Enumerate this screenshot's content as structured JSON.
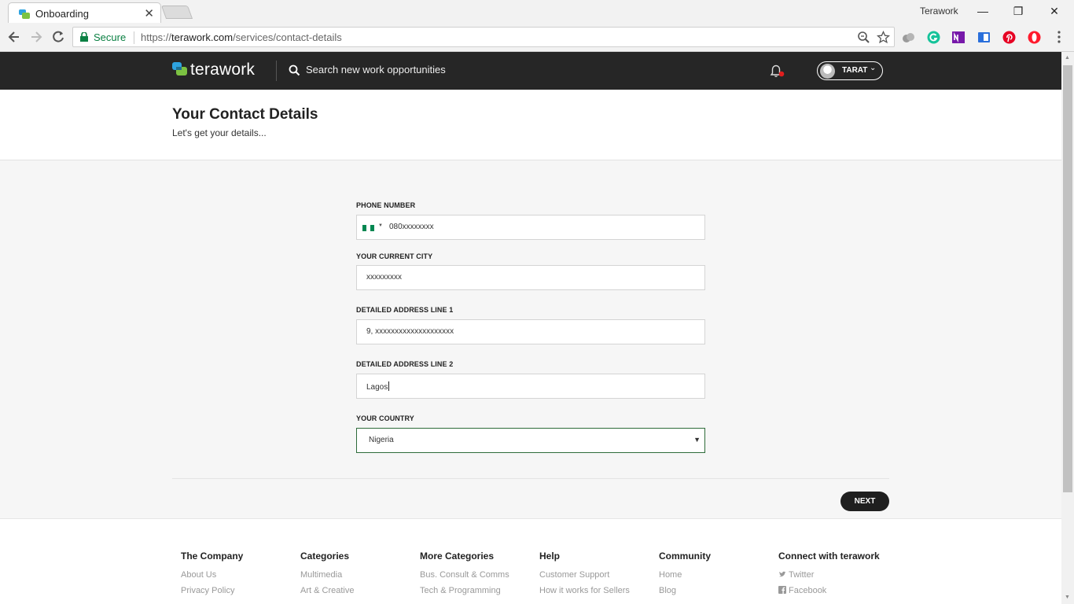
{
  "browser": {
    "tab_title": "Onboarding",
    "tab_close": "✕",
    "profile_name": "Terawork",
    "window_controls": {
      "minimize": "—",
      "restore": "❐",
      "close": "✕"
    },
    "secure_label": "Secure",
    "url_scheme": "https://",
    "url_host": "terawork.com",
    "url_path": "/services/contact-details",
    "extensions": [
      "cloud-icon",
      "grammarly-icon",
      "onenote-icon",
      "reader-icon",
      "pinterest-icon",
      "opera-icon"
    ]
  },
  "header": {
    "logo_text": "terawork",
    "search_placeholder": "Search new work opportunities",
    "user_name": "TARAT",
    "user_chevron": "⌄",
    "notification_dot_color": "#e01e1e"
  },
  "page": {
    "title": "Your Contact Details",
    "subtitle": "Let's get your details..."
  },
  "form": {
    "phone_label": "PHONE NUMBER",
    "phone_value": "080xxxxxxxx",
    "city_label": "YOUR CURRENT CITY",
    "city_value": "xxxxxxxxx",
    "address1_label": "DETAILED ADDRESS LINE 1",
    "address1_value": "9, xxxxxxxxxxxxxxxxxxxx",
    "address2_label": "DETAILED ADDRESS LINE 2",
    "address2_value": "Lagos",
    "country_label": "YOUR COUNTRY",
    "country_value": "Nigeria",
    "next_label": "NEXT"
  },
  "footer": {
    "columns": [
      {
        "title": "The Company",
        "links": [
          "About Us",
          "Privacy Policy"
        ]
      },
      {
        "title": "Categories",
        "links": [
          "Multimedia",
          "Art & Creative"
        ]
      },
      {
        "title": "More Categories",
        "links": [
          "Bus. Consult & Comms",
          "Tech & Programming"
        ]
      },
      {
        "title": "Help",
        "links": [
          "Customer Support",
          "How it works for Sellers"
        ]
      },
      {
        "title": "Community",
        "links": [
          "Home",
          "Blog"
        ]
      },
      {
        "title": "Connect with terawork",
        "links": [
          "Twitter",
          "Facebook"
        ]
      }
    ]
  },
  "colors": {
    "header_bg": "#262626",
    "secure_green": "#0b8043",
    "select_border": "#2e6b3a",
    "nigeria_green": "#008751"
  }
}
